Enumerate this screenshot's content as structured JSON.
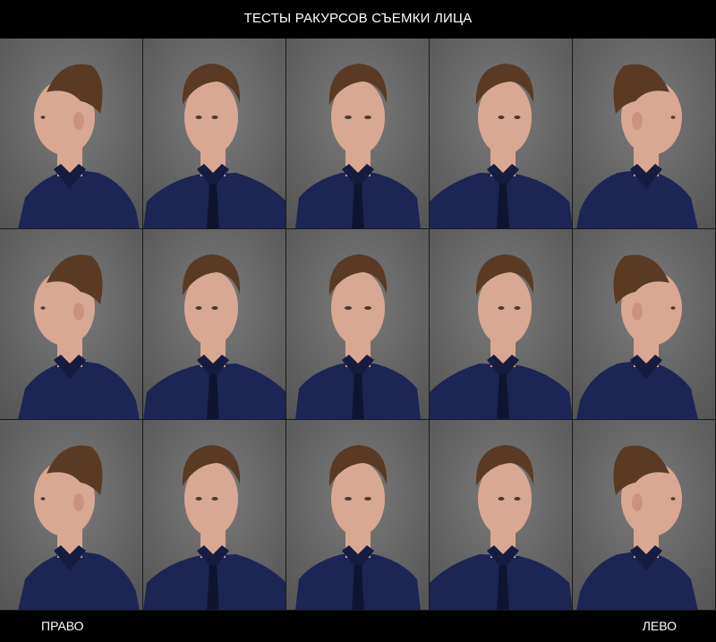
{
  "title": "ТЕСТЫ РАКУРСОВ СЪЕМКИ ЛИЦА",
  "footer": {
    "left_label": "ПРАВО",
    "right_label": "ЛЕВО"
  },
  "colors": {
    "background": "#000000",
    "photo_backdrop": "#6b6b6b",
    "shirt": "#1c2554",
    "hair": "#5a3a22",
    "skin": "#d9a892"
  },
  "grid": {
    "rows": 3,
    "columns": 5
  },
  "photos": [
    {
      "row": "top",
      "view": "profile-facing-left"
    },
    {
      "row": "top",
      "view": "three-quarter-left"
    },
    {
      "row": "top",
      "view": "front"
    },
    {
      "row": "top",
      "view": "three-quarter-right"
    },
    {
      "row": "top",
      "view": "profile-facing-right"
    },
    {
      "row": "middle",
      "view": "profile-facing-left"
    },
    {
      "row": "middle",
      "view": "three-quarter-left"
    },
    {
      "row": "middle",
      "view": "front"
    },
    {
      "row": "middle",
      "view": "three-quarter-right"
    },
    {
      "row": "middle",
      "view": "profile-facing-right"
    },
    {
      "row": "bottom",
      "view": "profile-facing-left"
    },
    {
      "row": "bottom",
      "view": "three-quarter-left"
    },
    {
      "row": "bottom",
      "view": "front"
    },
    {
      "row": "bottom",
      "view": "three-quarter-right"
    },
    {
      "row": "bottom",
      "view": "profile-facing-right"
    }
  ]
}
